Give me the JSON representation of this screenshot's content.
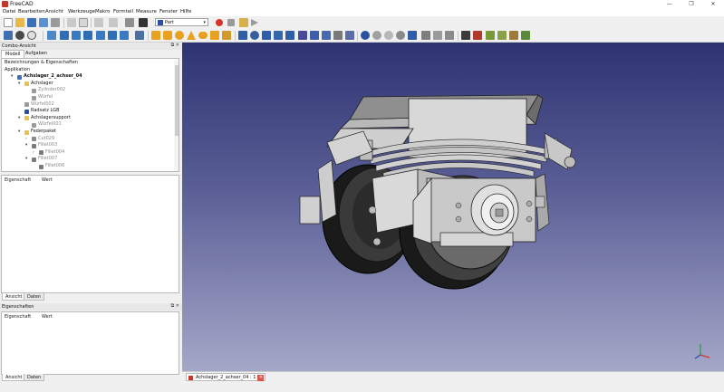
{
  "window": {
    "title": "FreeCAD",
    "minimize": "—",
    "maximize": "❐",
    "close": "✕"
  },
  "menu": [
    "Datei",
    "Bearbeiten",
    "Ansicht",
    "Werkzeuge",
    "Makro",
    "Formteil",
    "Measure",
    "Fenster",
    "Hilfe"
  ],
  "workbench": {
    "selected": "Part",
    "arrow": "▾"
  },
  "combo": {
    "title": "Combo-Ansicht",
    "buttons": "⧉ ✕",
    "tabs": [
      "Modell",
      "Aufgaben"
    ],
    "tree": [
      {
        "label": "Bezeichnungen & Eigenschaften",
        "indent": 0,
        "arrow": "",
        "style": "normal"
      },
      {
        "label": "Applikation",
        "indent": 0,
        "arrow": "",
        "style": "normal"
      },
      {
        "label": "Achslager_2_achser_04",
        "indent": 1,
        "arrow": "▾",
        "style": "bold",
        "icon": "doc"
      },
      {
        "label": "Achslager",
        "indent": 2,
        "arrow": "▾",
        "style": "normal",
        "icon": "folder"
      },
      {
        "label": "Zylinder002",
        "indent": 3,
        "arrow": "",
        "style": "gray",
        "icon": "solid"
      },
      {
        "label": "Würfel",
        "indent": 3,
        "arrow": "",
        "style": "gray",
        "icon": "solid"
      },
      {
        "label": "Würfel002",
        "indent": 2,
        "arrow": "",
        "style": "gray",
        "icon": "solid"
      },
      {
        "label": "Radsatz LGB",
        "indent": 2,
        "arrow": "",
        "style": "normal",
        "icon": "part"
      },
      {
        "label": "Achslagersupport",
        "indent": 2,
        "arrow": "▾",
        "style": "normal",
        "icon": "folder"
      },
      {
        "label": "Würfel001",
        "indent": 3,
        "arrow": "",
        "style": "gray",
        "icon": "solid"
      },
      {
        "label": "Federpaket",
        "indent": 2,
        "arrow": "▾",
        "style": "normal",
        "icon": "folder"
      },
      {
        "label": "Cut029",
        "indent": 3,
        "arrow": "›",
        "style": "gray",
        "icon": "cut"
      },
      {
        "label": "Fillet003",
        "indent": 3,
        "arrow": "▾",
        "style": "gray",
        "icon": "fillet"
      },
      {
        "label": "Fillet004",
        "indent": 4,
        "arrow": "›",
        "style": "gray",
        "icon": "fillet"
      },
      {
        "label": "Fillet007",
        "indent": 3,
        "arrow": "▾",
        "style": "gray",
        "icon": "fillet"
      },
      {
        "label": "Fillet006",
        "indent": 4,
        "arrow": "",
        "style": "gray",
        "icon": "fillet"
      }
    ],
    "property_headers": [
      "Eigenschaft",
      "Wert"
    ],
    "bottom_tabs": [
      "Ansicht",
      "Daten"
    ]
  },
  "properties_panel": {
    "title": "Eigenschaften",
    "buttons": "⧉ ✕",
    "property_headers": [
      "Eigenschaft",
      "Wert"
    ],
    "bottom_tabs": [
      "Ansicht",
      "Daten"
    ]
  },
  "document_tab": {
    "label": "Achslager_2_achser_04 : 1",
    "close": "✕"
  },
  "colors": {
    "viewport_top": "#2e3372",
    "viewport_bottom": "#a5a7c8",
    "accent_red": "#c0392b",
    "blue_icon": "#2a4fa8"
  }
}
